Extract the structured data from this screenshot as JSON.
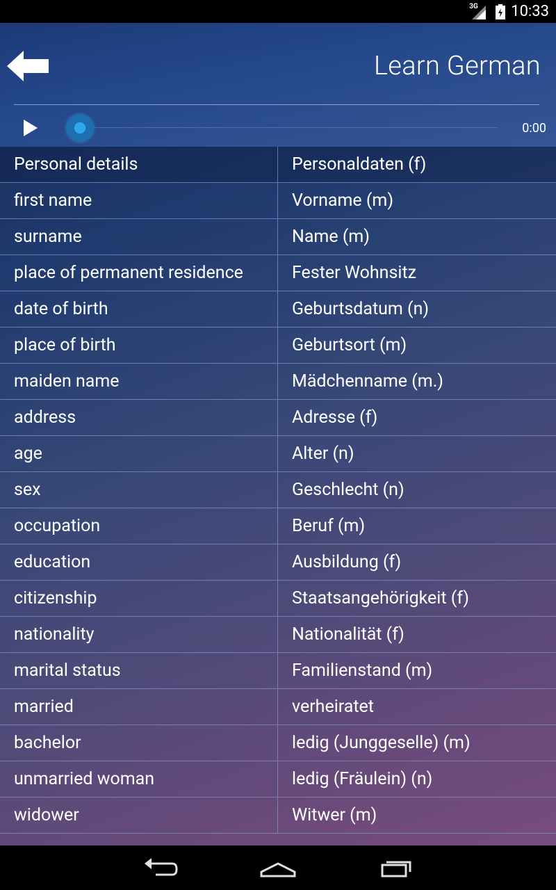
{
  "status_bar": {
    "network": "3G",
    "time": "10:33"
  },
  "header": {
    "title": "Learn German",
    "back_icon": "back-arrow-icon"
  },
  "player": {
    "play_icon": "play-icon",
    "time": "0:00"
  },
  "rows": [
    {
      "en": "Personal details",
      "de": "Personaldaten (f)"
    },
    {
      "en": "first name",
      "de": "Vorname (m)"
    },
    {
      "en": "surname",
      "de": "Name (m)"
    },
    {
      "en": "place of permanent residence",
      "de": "Fester Wohnsitz"
    },
    {
      "en": "date of birth",
      "de": "Geburtsdatum (n)"
    },
    {
      "en": "place of birth",
      "de": "Geburtsort (m)"
    },
    {
      "en": "maiden name",
      "de": "Mädchenname (m.)"
    },
    {
      "en": "address",
      "de": "Adresse (f)"
    },
    {
      "en": "age",
      "de": "Alter (n)"
    },
    {
      "en": "sex",
      "de": "Geschlecht (n)"
    },
    {
      "en": "occupation",
      "de": "Beruf (m)"
    },
    {
      "en": "education",
      "de": "Ausbildung (f)"
    },
    {
      "en": "citizenship",
      "de": "Staatsangehörigkeit (f)"
    },
    {
      "en": "nationality",
      "de": "Nationalität (f)"
    },
    {
      "en": "marital status",
      "de": "Familienstand (m)"
    },
    {
      "en": "married",
      "de": "verheiratet"
    },
    {
      "en": "bachelor",
      "de": "ledig (Junggeselle) (m)"
    },
    {
      "en": "unmarried woman",
      "de": "ledig (Fräulein) (n)"
    },
    {
      "en": "widower",
      "de": "Witwer (m)"
    }
  ],
  "nav": {
    "back_icon": "nav-back-icon",
    "home_icon": "nav-home-icon",
    "recent_icon": "nav-recent-apps-icon"
  }
}
